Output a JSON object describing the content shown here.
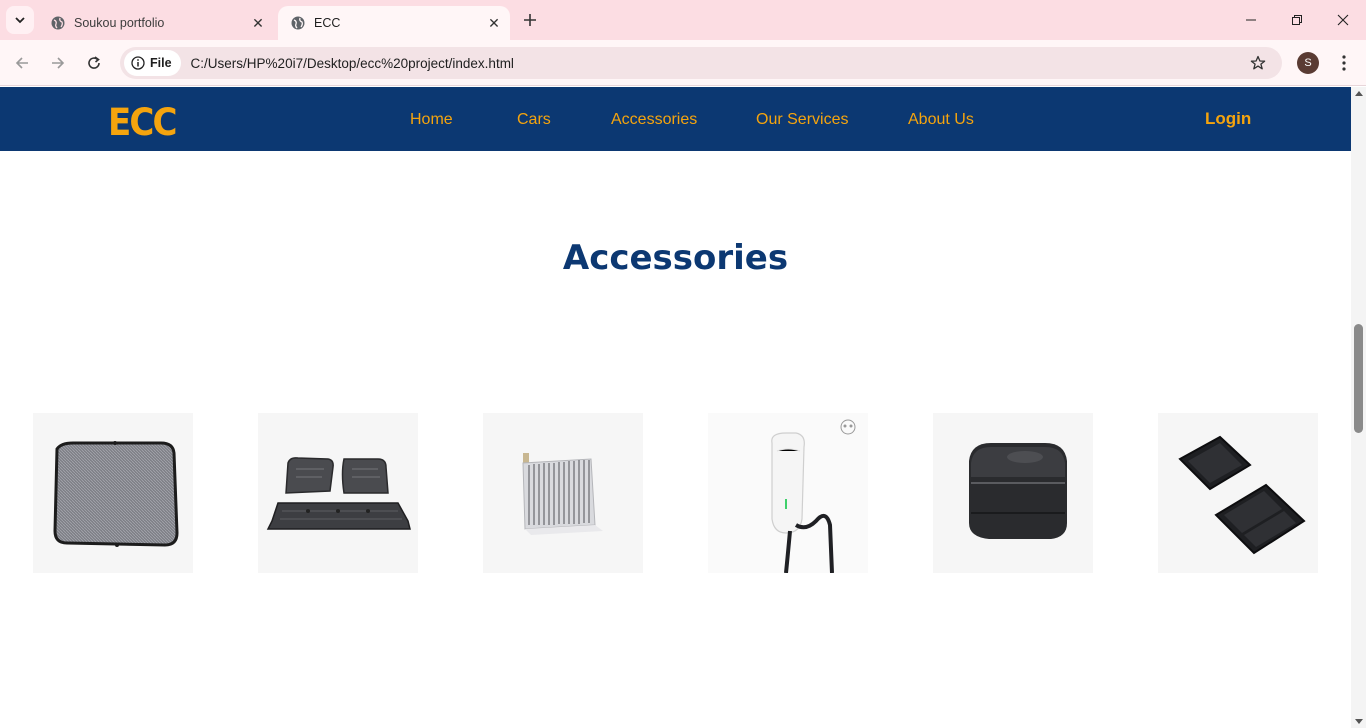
{
  "browser": {
    "tabs": [
      {
        "title": "Soukou portfolio",
        "active": false
      },
      {
        "title": "ECC",
        "active": true
      }
    ],
    "address": {
      "scheme_label": "File",
      "url": "C:/Users/HP%20i7/Desktop/ecc%20project/index.html"
    },
    "profile_initial": "S"
  },
  "site": {
    "logo": "ECC",
    "nav": [
      "Home",
      "Cars",
      "Accessories",
      "Our Services",
      "About Us"
    ],
    "login": "Login",
    "colors": {
      "nav_bg": "#0c3872",
      "accent": "#f5a40e",
      "title": "#0c3872"
    }
  },
  "accessories": {
    "title": "Accessories",
    "items": [
      {
        "icon": "sunshade-icon"
      },
      {
        "icon": "floor-mats-icon"
      },
      {
        "icon": "cabin-air-filter-icon"
      },
      {
        "icon": "wall-charger-icon"
      },
      {
        "icon": "storage-box-icon"
      },
      {
        "icon": "console-trays-icon"
      }
    ]
  }
}
